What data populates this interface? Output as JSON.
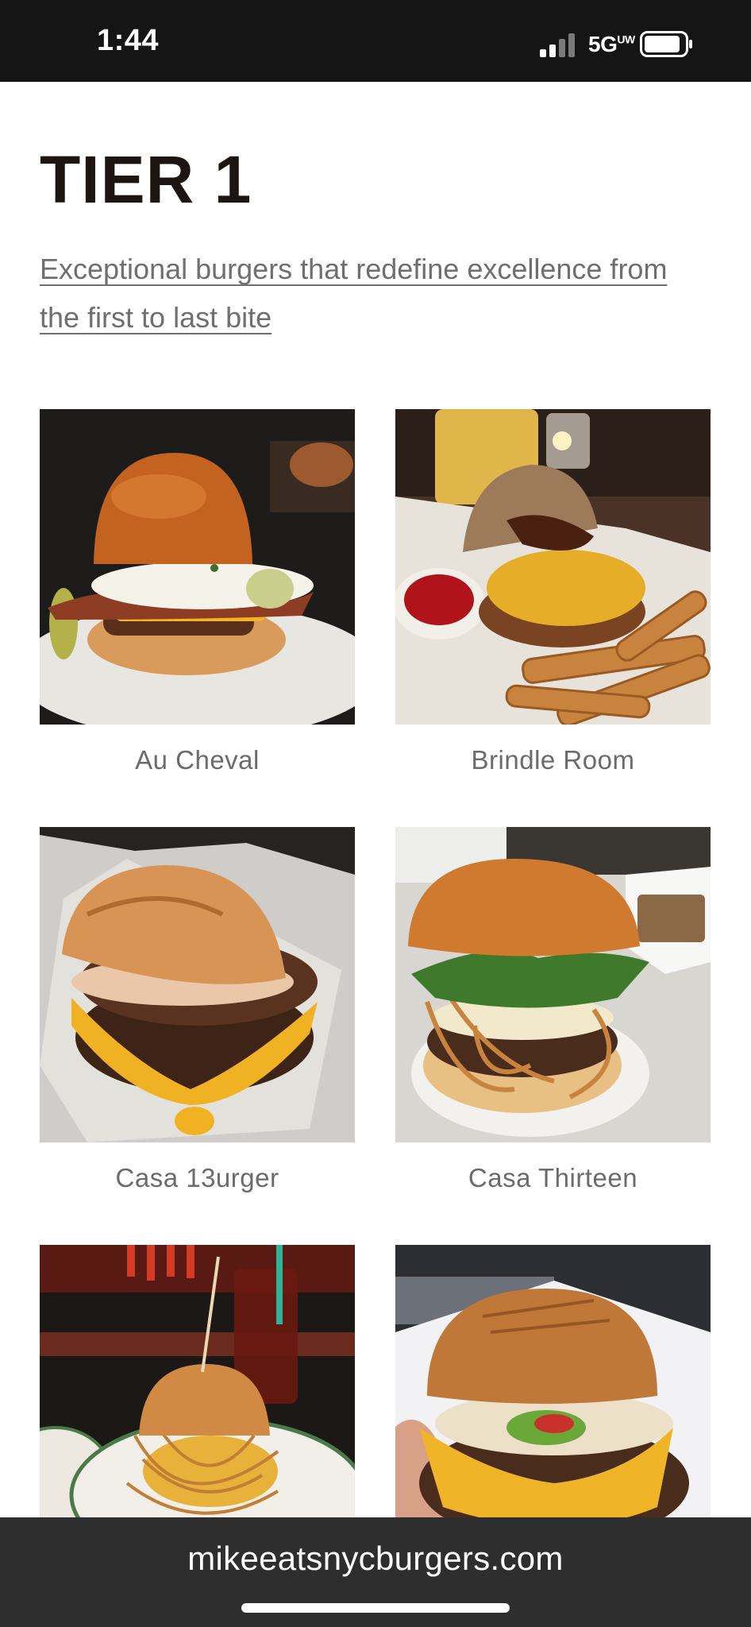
{
  "status_bar": {
    "time": "1:44",
    "network": "5G",
    "network_badge": "UW"
  },
  "page": {
    "title": "TIER 1",
    "subtitle": "Exceptional burgers that redefine excellence from the first to last bite"
  },
  "burgers": [
    {
      "name": "Au Cheval"
    },
    {
      "name": "Brindle Room"
    },
    {
      "name": "Casa 13urger"
    },
    {
      "name": "Casa Thirteen"
    },
    {
      "name": ""
    },
    {
      "name": ""
    }
  ],
  "browser": {
    "url": "mikeeatsnycburgers.com"
  },
  "colors": {
    "status_bar_bg": "#151515",
    "title_text": "#1d1512",
    "subtitle_text": "#6f6f6f",
    "bottom_bar_bg": "#2f2e2f"
  }
}
